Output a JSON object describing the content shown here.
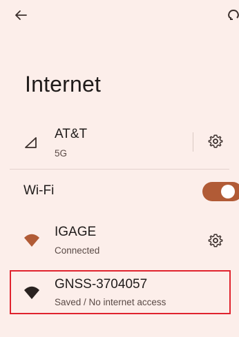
{
  "header": {
    "back_icon": "arrow-left-icon",
    "corner_icon": "overflow-icon",
    "title": "Internet"
  },
  "mobile": {
    "carrier": "AT&T",
    "network_type": "5G",
    "signal_icon": "cellular-signal-icon",
    "settings_icon": "gear-icon"
  },
  "wifi": {
    "label": "Wi-Fi",
    "toggle_state": "on",
    "networks": [
      {
        "name": "IGAGE",
        "status": "Connected",
        "icon": "wifi-icon",
        "settings_icon": "gear-icon"
      },
      {
        "name": "GNSS-3704057",
        "status": "Saved / No internet access",
        "icon": "wifi-icon"
      }
    ]
  },
  "colors": {
    "background": "#FCEEEA",
    "accent": "#B15B36",
    "highlight_border": "#E0222D"
  }
}
